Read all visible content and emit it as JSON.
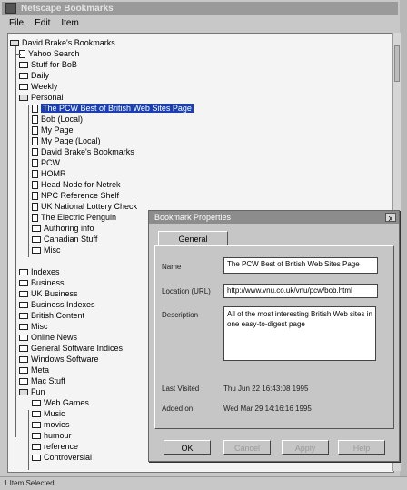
{
  "window": {
    "title": "Netscape Bookmarks",
    "menu": [
      "File",
      "Edit",
      "Item"
    ]
  },
  "tree": {
    "root": "David Brake's Bookmarks",
    "items": [
      "Yahoo Search",
      "Stuff for BoB",
      "Daily",
      "Weekly",
      "Personal",
      "The PCW Best of British Web Sites Page",
      "Bob (Local)",
      "My Page",
      "My Page (Local)",
      "David Brake's Bookmarks",
      "PCW",
      "HOMR",
      "Head Node for Netrek",
      "NPC Reference Shelf",
      "UK National Lottery Check",
      "The Electric Penguin",
      "Authoring info",
      "Canadian Stuff",
      "Misc",
      "Indexes",
      "Business",
      "UK Business",
      "Business Indexes",
      "British Content",
      "Misc",
      "Online News",
      "General Software Indices",
      "Windows Software",
      "Meta",
      "Mac Stuff",
      "Fun",
      "Web Games",
      "Music",
      "movies",
      "humour",
      "reference",
      "Controversial"
    ]
  },
  "status": "1 Item Selected",
  "dialog": {
    "title": "Bookmark Properties",
    "close": "x",
    "tab": "General",
    "name_label": "Name",
    "name_value": "The PCW Best of British Web Sites Page",
    "location_label": "Location (URL)",
    "location_value": "http://www.vnu.co.uk/vnu/pcw/bob.html",
    "description_label": "Description",
    "description_value": "All of the most interesting British Web sites in one easy-to-digest page",
    "last_visited_label": "Last Visited",
    "last_visited_value": "Thu Jun 22 16:43:08 1995",
    "added_on_label": "Added on:",
    "added_on_value": "Wed Mar 29 14:16:16 1995",
    "buttons": [
      "OK",
      "Cancel",
      "Apply",
      "Help"
    ]
  }
}
